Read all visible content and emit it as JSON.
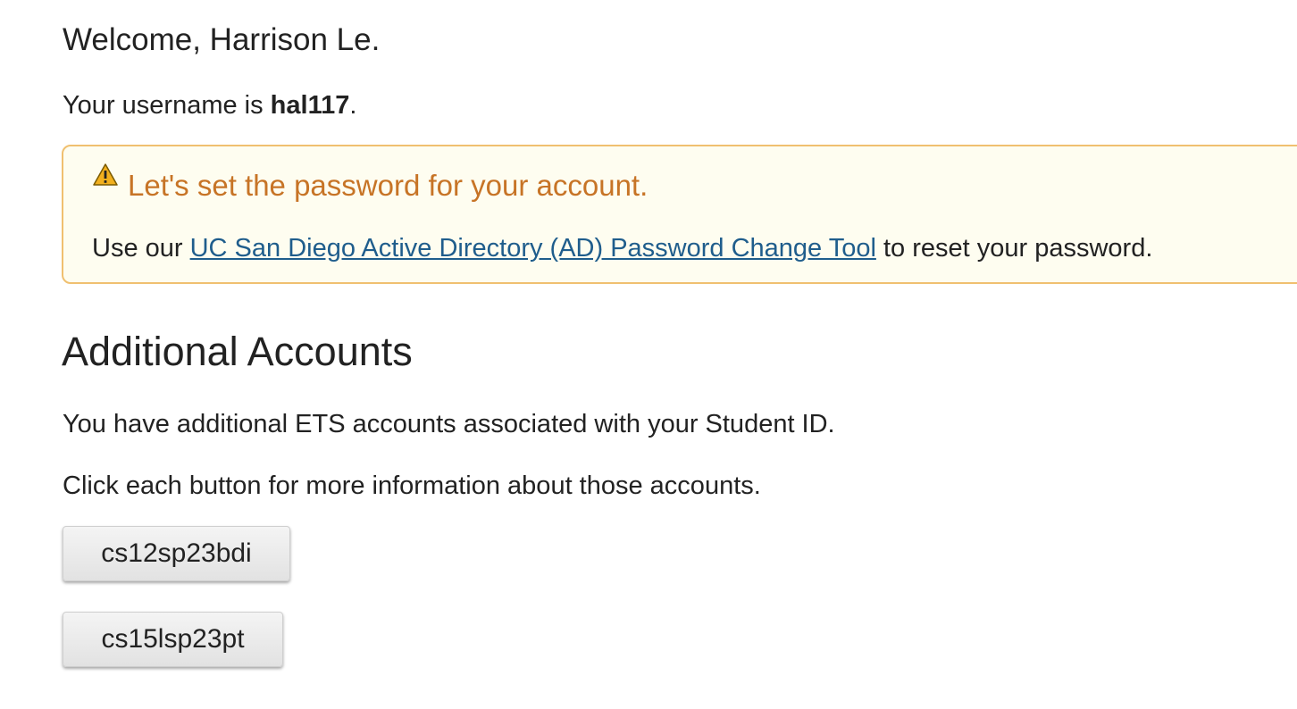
{
  "welcome": {
    "text": "Welcome, Harrison Le."
  },
  "username": {
    "prefix": "Your username is ",
    "value": "hal117",
    "suffix": "."
  },
  "alert": {
    "icon": "warning-icon",
    "title": "Let's set the password for your account.",
    "body_prefix": "Use our ",
    "link_text": "UC San Diego Active Directory (AD) Password Change Tool",
    "body_suffix": " to reset your password.",
    "title_color": "#c77426",
    "link_color": "#1f5d8c",
    "background_color": "#fefdf0",
    "border_color": "#f0c070"
  },
  "additional": {
    "title": "Additional Accounts",
    "line1": "You have additional ETS accounts associated with your Student ID.",
    "line2": "Click each button for more information about those accounts.",
    "accounts": [
      {
        "label": "cs12sp23bdi"
      },
      {
        "label": "cs15lsp23pt"
      }
    ]
  }
}
